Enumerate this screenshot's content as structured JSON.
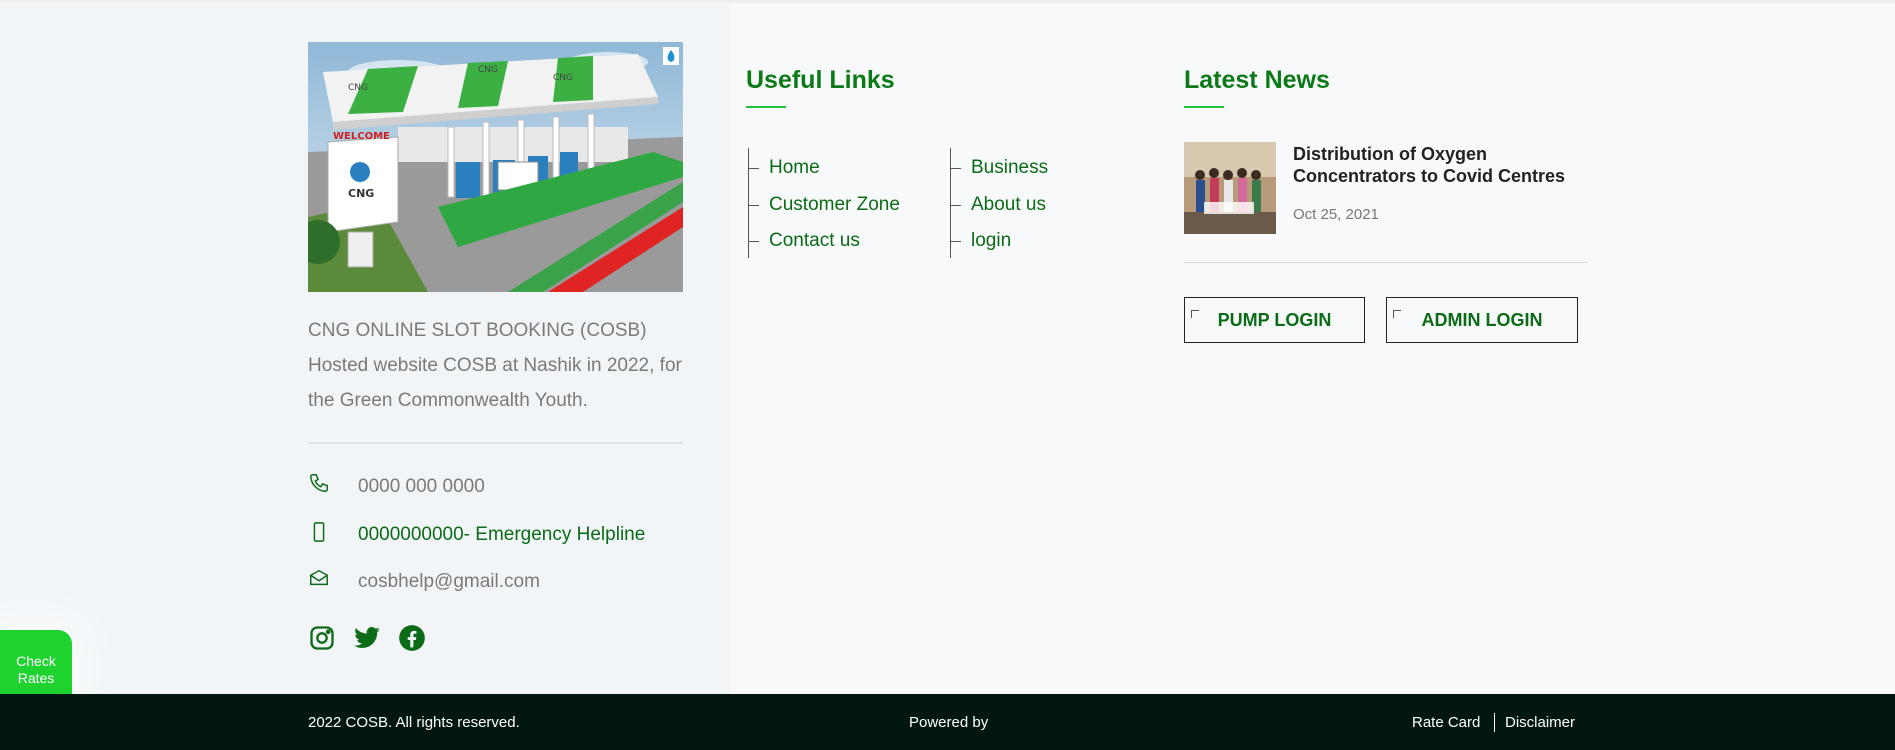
{
  "about": {
    "image_alt": "CNG station illustration",
    "image_signs": [
      "CNG",
      "CNG",
      "CNG",
      "WELCOME",
      "CNG"
    ],
    "description": "CNG ONLINE SLOT BOOKING (COSB) Hosted website COSB at Nashik in 2022, for the Green Commonwealth Youth."
  },
  "contact": {
    "phone": "0000 000 0000",
    "emergency": "0000000000- Emergency Helpline",
    "email": "cosbhelp@gmail.com"
  },
  "socials": [
    "instagram-icon",
    "twitter-icon",
    "facebook-icon"
  ],
  "useful_links": {
    "heading": "Useful Links",
    "col1": [
      "Home",
      "Customer Zone",
      "Contact us"
    ],
    "col2": [
      "Business",
      "About us",
      "login"
    ]
  },
  "latest_news": {
    "heading": "Latest News",
    "title": "Distribution of Oxygen Concentrators to Covid Centres",
    "date": "Oct 25, 2021"
  },
  "buttons": {
    "pump_login": "PUMP LOGIN",
    "admin_login": "ADMIN LOGIN"
  },
  "check_rates": "Check Rates",
  "footer": {
    "copyright": "2022 COSB. All rights reserved.",
    "powered_by": "Powered by",
    "rate_card": "Rate Card",
    "disclaimer": "Disclaimer"
  },
  "colors": {
    "brand_green": "#0c6b16",
    "accent_green": "#22c03b",
    "footer_bg": "#031711"
  }
}
